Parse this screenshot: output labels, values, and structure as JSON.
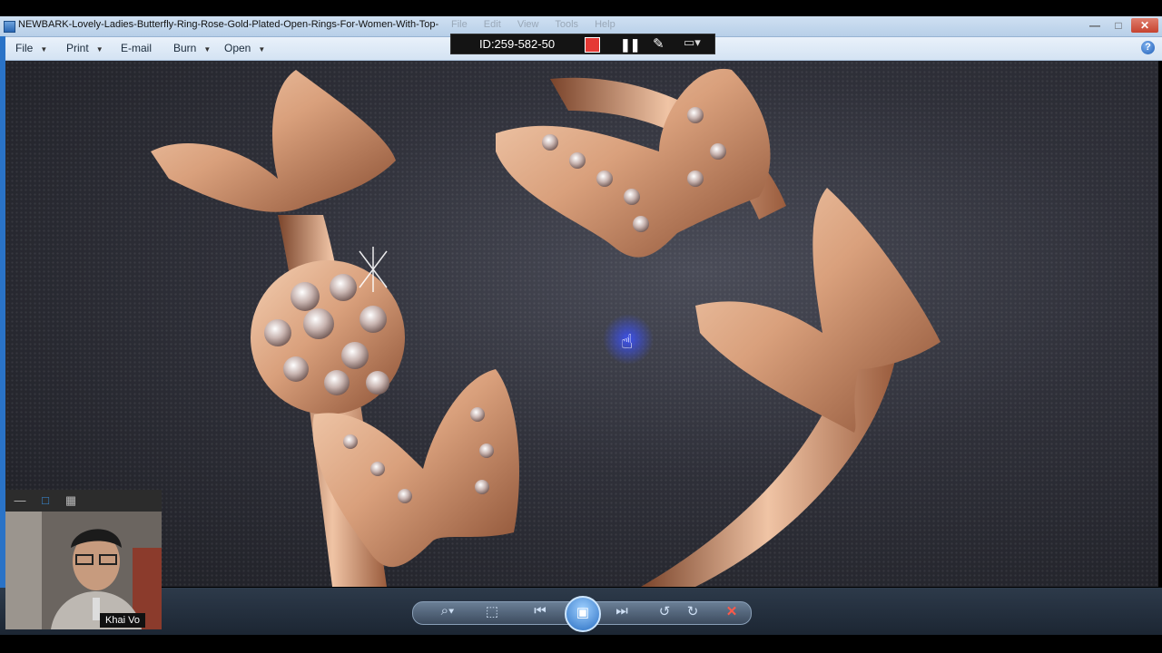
{
  "window": {
    "title": "NEWBARK-Lovely-Ladies-Butterfly-Ring-Rose-Gold-Plated-Open-Rings-For-Women-With-Top-",
    "bg_menu": [
      "File",
      "Edit",
      "View",
      "Tools",
      "Help"
    ],
    "minimize": "—",
    "maximize": "□",
    "close": "✕"
  },
  "menubar": {
    "file": "File",
    "print": "Print",
    "email": "E-mail",
    "burn": "Burn",
    "open": "Open",
    "help": "?"
  },
  "recorder": {
    "id_label": "ID:259-582-50",
    "pause": "❚❚",
    "pen": "✎",
    "screen": "▭▾"
  },
  "controls": {
    "zoom": "⌕▾",
    "fit": "⬚",
    "prev": "⏮",
    "slideshow": "▣",
    "next": "⏭",
    "rotate_ccw": "↺",
    "rotate_cw": "↻",
    "delete": "✕"
  },
  "webcam": {
    "name": "Khai Vo",
    "btn_min": "—",
    "btn_window": "□",
    "btn_grid": "▦"
  },
  "colors": {
    "accent": "#2a73c7",
    "rose_gold": "#d9a07c",
    "record": "#e53935"
  }
}
